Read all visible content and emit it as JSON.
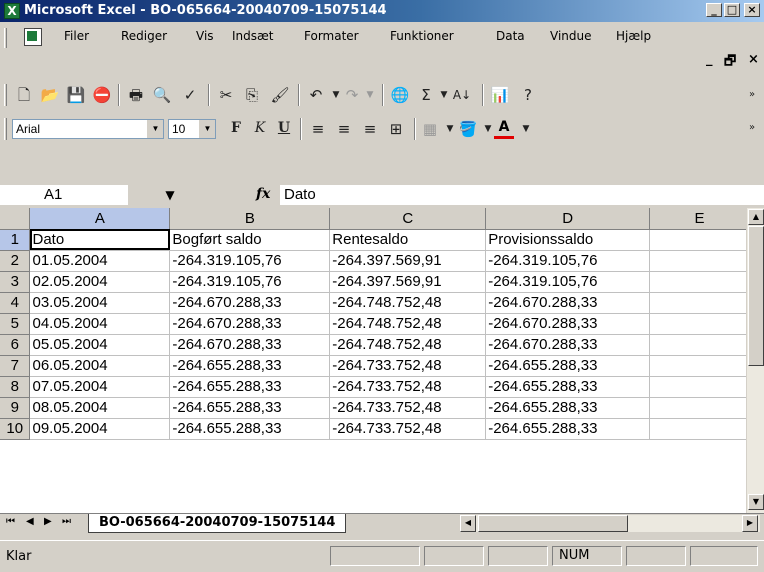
{
  "window": {
    "title": "Microsoft Excel - BO-065664-20040709-15075144",
    "buttons": {
      "minimize": "_",
      "maximize": "□",
      "close": "×"
    }
  },
  "menu": {
    "items": [
      "Filer",
      "Rediger",
      "Vis",
      "Indsæt",
      "Formater",
      "Funktioner",
      "Data",
      "Vindue",
      "Hjælp"
    ],
    "doc_controls": {
      "minimize": "_",
      "restore": "🗗",
      "close": "×"
    }
  },
  "toolbar_font": {
    "font_name": "Arial",
    "font_size": "10",
    "bold": "F",
    "italic": "K",
    "underline": "U"
  },
  "formula_bar": {
    "name_box": "A1",
    "fx": "fx",
    "content": "Dato"
  },
  "sheet": {
    "columns": [
      "A",
      "B",
      "C",
      "D",
      "E"
    ],
    "rows": [
      {
        "n": "1",
        "cells": [
          "Dato",
          "Bogført saldo",
          "Rentesaldo",
          "Provisionssaldo",
          ""
        ]
      },
      {
        "n": "2",
        "cells": [
          "01.05.2004",
          "-264.319.105,76",
          "-264.397.569,91",
          "-264.319.105,76",
          ""
        ]
      },
      {
        "n": "3",
        "cells": [
          "02.05.2004",
          "-264.319.105,76",
          "-264.397.569,91",
          "-264.319.105,76",
          ""
        ]
      },
      {
        "n": "4",
        "cells": [
          "03.05.2004",
          "-264.670.288,33",
          "-264.748.752,48",
          "-264.670.288,33",
          ""
        ]
      },
      {
        "n": "5",
        "cells": [
          "04.05.2004",
          "-264.670.288,33",
          "-264.748.752,48",
          "-264.670.288,33",
          ""
        ]
      },
      {
        "n": "6",
        "cells": [
          "05.05.2004",
          "-264.670.288,33",
          "-264.748.752,48",
          "-264.670.288,33",
          ""
        ]
      },
      {
        "n": "7",
        "cells": [
          "06.05.2004",
          "-264.655.288,33",
          "-264.733.752,48",
          "-264.655.288,33",
          ""
        ]
      },
      {
        "n": "8",
        "cells": [
          "07.05.2004",
          "-264.655.288,33",
          "-264.733.752,48",
          "-264.655.288,33",
          ""
        ]
      },
      {
        "n": "9",
        "cells": [
          "08.05.2004",
          "-264.655.288,33",
          "-264.733.752,48",
          "-264.655.288,33",
          ""
        ]
      },
      {
        "n": "10",
        "cells": [
          "09.05.2004",
          "-264.655.288,33",
          "-264.733.752,48",
          "-264.655.288,33",
          ""
        ]
      }
    ],
    "tab_name": "BO-065664-20040709-15075144"
  },
  "status": {
    "ready": "Klar",
    "num": "NUM"
  },
  "colors": {
    "title_gradient_start": "#0a246a",
    "title_gradient_end": "#a6caf0",
    "chrome": "#d4d0c8",
    "selected_header": "#b6c6e8"
  }
}
